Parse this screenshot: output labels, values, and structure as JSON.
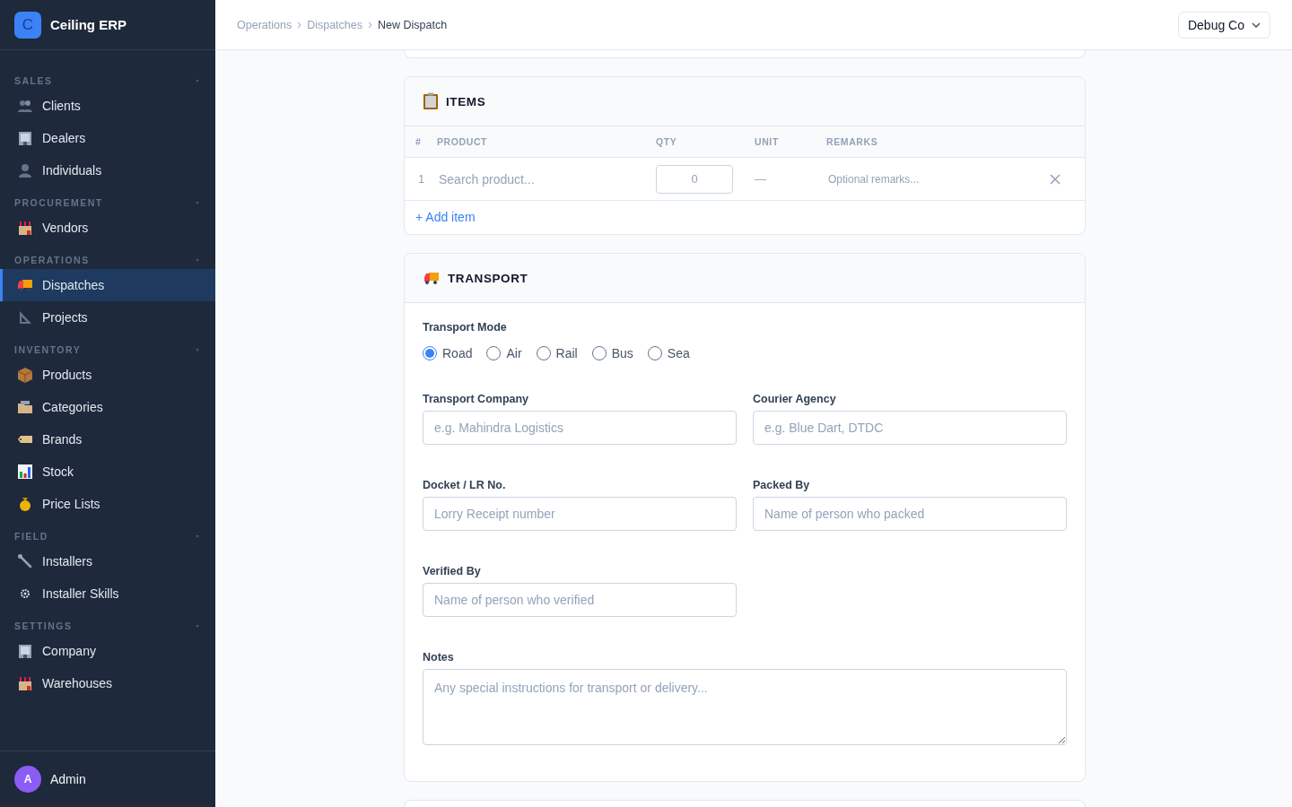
{
  "app": {
    "logo_letter": "C",
    "name": "Ceiling ERP"
  },
  "sidebar": {
    "sections": [
      {
        "title": "SALES",
        "expanded": true,
        "items": [
          {
            "label": "Clients",
            "selected": false
          },
          {
            "label": "Dealers",
            "selected": false
          },
          {
            "label": "Individuals",
            "selected": false
          }
        ]
      },
      {
        "title": "PROCUREMENT",
        "expanded": true,
        "items": [
          {
            "label": "Vendors",
            "selected": false
          }
        ]
      },
      {
        "title": "OPERATIONS",
        "expanded": true,
        "items": [
          {
            "label": "Dispatches",
            "selected": true
          },
          {
            "label": "Projects",
            "selected": false
          }
        ]
      },
      {
        "title": "INVENTORY",
        "expanded": true,
        "items": [
          {
            "label": "Products",
            "selected": false
          },
          {
            "label": "Categories",
            "selected": false
          },
          {
            "label": "Brands",
            "selected": false
          },
          {
            "label": "Stock",
            "selected": false
          },
          {
            "label": "Price Lists",
            "selected": false
          }
        ]
      },
      {
        "title": "FIELD",
        "expanded": true,
        "items": [
          {
            "label": "Installers",
            "selected": false
          },
          {
            "label": "Installer Skills",
            "selected": false
          }
        ]
      },
      {
        "title": "SETTINGS",
        "expanded": true,
        "items": [
          {
            "label": "Company",
            "selected": false
          },
          {
            "label": "Warehouses",
            "selected": false
          }
        ]
      }
    ],
    "user": {
      "initial": "A",
      "name": "Admin"
    }
  },
  "breadcrumbs": [
    "Operations",
    "Dispatches",
    "New Dispatch"
  ],
  "company_selector": "Debug Co",
  "items": {
    "title": "ITEMS",
    "columns": [
      "#",
      "PRODUCT",
      "QTY",
      "UNIT",
      "REMARKS"
    ],
    "rows": [
      {
        "index": "1",
        "product_placeholder": "Search product...",
        "qty": "0",
        "unit": "—",
        "remarks_placeholder": "Optional remarks..."
      }
    ],
    "add_link": "+ Add item"
  },
  "transport": {
    "title": "TRANSPORT",
    "mode_label": "Transport Mode",
    "modes": [
      {
        "label": "Road",
        "selected": true
      },
      {
        "label": "Air",
        "selected": false
      },
      {
        "label": "Rail",
        "selected": false
      },
      {
        "label": "Bus",
        "selected": false
      },
      {
        "label": "Sea",
        "selected": false
      }
    ],
    "fields": [
      {
        "label": "Transport Company",
        "placeholder": "e.g. Mahindra Logistics"
      },
      {
        "label": "Courier Agency",
        "placeholder": "e.g. Blue Dart, DTDC"
      },
      {
        "label": "Docket / LR No.",
        "placeholder": "Lorry Receipt number"
      },
      {
        "label": "Packed By",
        "placeholder": "Name of person who packed"
      },
      {
        "label": "Verified By",
        "placeholder": "Name of person who verified"
      }
    ],
    "notes": {
      "label": "Notes",
      "placeholder": "Any special instructions for transport or delivery..."
    }
  }
}
